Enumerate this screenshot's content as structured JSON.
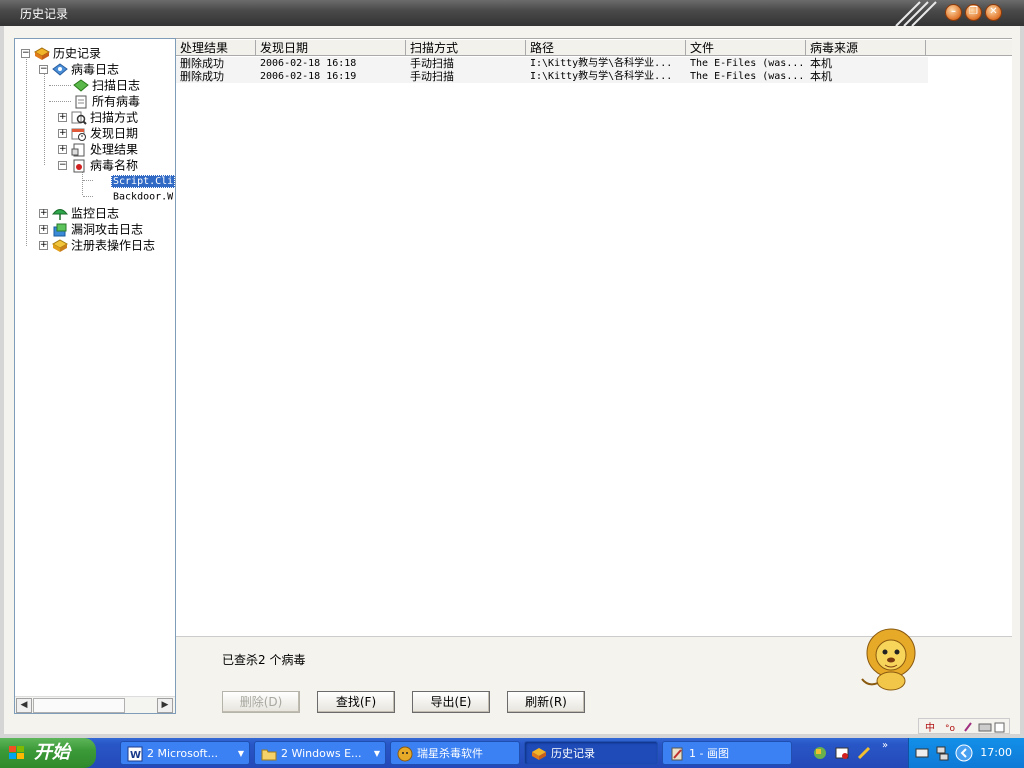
{
  "window": {
    "title": "历史记录"
  },
  "tree": {
    "root": "历史记录",
    "virus_log": "病毒日志",
    "scan_log": "扫描日志",
    "all_viruses": "所有病毒",
    "scan_method": "扫描方式",
    "found_date": "发现日期",
    "result": "处理结果",
    "virus_name": "病毒名称",
    "leaf_1": "Script.Cli",
    "leaf_2": "Backdoor.W",
    "monitor_log": "监控日志",
    "exploit_log": "漏洞攻击日志",
    "registry_log": "注册表操作日志"
  },
  "list": {
    "columns": [
      "处理结果",
      "发现日期",
      "扫描方式",
      "路径",
      "文件",
      "病毒来源"
    ],
    "rows": [
      {
        "result": "删除成功",
        "date": "2006-02-18 16:18",
        "method": "手动扫描",
        "path": "I:\\Kitty教与学\\各科学业...",
        "file": "The E-Files (was...",
        "source": "本机"
      },
      {
        "result": "删除成功",
        "date": "2006-02-18 16:19",
        "method": "手动扫描",
        "path": "I:\\Kitty教与学\\各科学业...",
        "file": "The E-Files (was...",
        "source": "本机"
      }
    ]
  },
  "bottom": {
    "status": "已查杀2 个病毒",
    "delete_label": "删除(D)",
    "find_label": "查找(F)",
    "export_label": "导出(E)",
    "refresh_label": "刷新(R)"
  },
  "taskbar": {
    "start_label": "开始",
    "tasks": [
      {
        "label": "2 Microsoft...",
        "icon": "word-icon"
      },
      {
        "label": "2 Windows E...",
        "icon": "folder-icon"
      },
      {
        "label": "瑞星杀毒软件",
        "icon": "rising-icon"
      },
      {
        "label": "历史记录",
        "icon": "history-icon"
      },
      {
        "label": "1 - 画图",
        "icon": "paint-icon"
      }
    ],
    "clock": "17:00"
  },
  "colors": {
    "titlebar": "#4a4a4a",
    "taskbar": "#2448b8",
    "start": "#3c9a38",
    "selection": "#316ac5"
  }
}
